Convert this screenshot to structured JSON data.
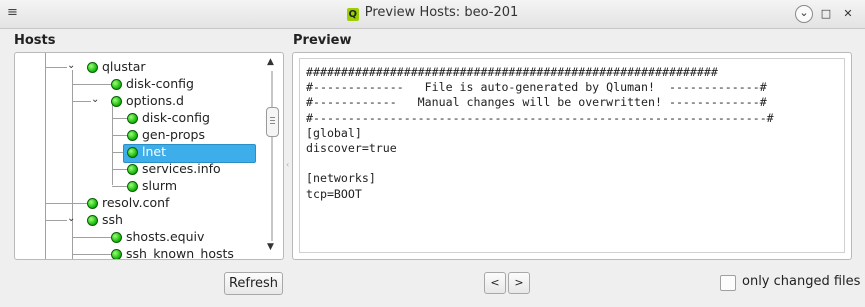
{
  "window": {
    "title": "Preview Hosts: beo-201",
    "app_icon_letter": "Q",
    "menu_glyph": "≡",
    "minimize_glyph": "⌄",
    "maximize_glyph": "□",
    "close_glyph": "✕"
  },
  "hosts": {
    "label": "Hosts",
    "tree": [
      {
        "label": "qlustar",
        "level": 0,
        "expanded": true
      },
      {
        "label": "disk-config",
        "level": 1
      },
      {
        "label": "options.d",
        "level": 1,
        "expanded": true
      },
      {
        "label": "disk-config",
        "level": 2
      },
      {
        "label": "gen-props",
        "level": 2
      },
      {
        "label": "lnet",
        "level": 2,
        "selected": true
      },
      {
        "label": "services.info",
        "level": 2
      },
      {
        "label": "slurm",
        "level": 2
      },
      {
        "label": "resolv.conf",
        "level": 0
      },
      {
        "label": "ssh",
        "level": 0,
        "expanded": true
      },
      {
        "label": "shosts.equiv",
        "level": 1
      },
      {
        "label": "ssh_known_hosts",
        "level": 1
      }
    ],
    "expand_glyph": "⌄",
    "scroll_up_glyph": "▲",
    "scroll_down_glyph": "▼"
  },
  "preview": {
    "label": "Preview",
    "text": "###########################################################\n#-------------   File is auto-generated by Qluman!  -------------#\n#------------   Manual changes will be overwritten! -------------#\n#-----------------------------------------------------------------#\n[global]\ndiscover=true\n\n[networks]\ntcp=BOOT"
  },
  "buttons": {
    "refresh": "Refresh",
    "prev": "<",
    "next": ">"
  },
  "only_changed": {
    "label": "only changed files",
    "checked": false
  },
  "colors": {
    "selection": "#3daee9",
    "status_ok": "#1fbf10"
  }
}
